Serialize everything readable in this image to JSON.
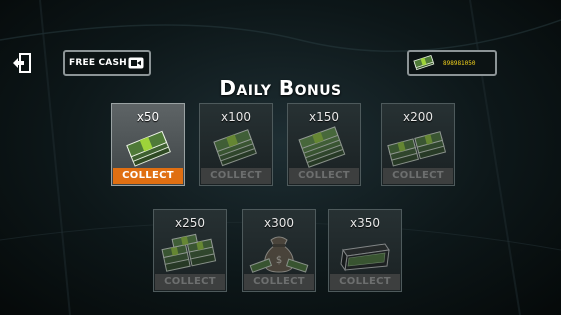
{
  "header": {
    "free_cash_label": "FREE CASH",
    "balance": "898981050"
  },
  "title": "Daily Bonus",
  "bonuses": [
    {
      "label": "x50",
      "button": "COLLECT",
      "active": true
    },
    {
      "label": "x100",
      "button": "COLLECT",
      "active": false
    },
    {
      "label": "x150",
      "button": "COLLECT",
      "active": false
    },
    {
      "label": "x200",
      "button": "COLLECT",
      "active": false
    },
    {
      "label": "x250",
      "button": "COLLECT",
      "active": false
    },
    {
      "label": "x300",
      "button": "COLLECT",
      "active": false
    },
    {
      "label": "x350",
      "button": "COLLECT",
      "active": false
    }
  ],
  "icons": {
    "exit": "exit-icon",
    "video": "video-camera-icon",
    "cash": "cash-stack-icon",
    "bag": "money-bag-icon",
    "case": "money-briefcase-icon"
  },
  "colors": {
    "collect_active": "#e06f12",
    "collect_inactive": "#3d3f3f",
    "balance_text": "#f2d21c"
  }
}
